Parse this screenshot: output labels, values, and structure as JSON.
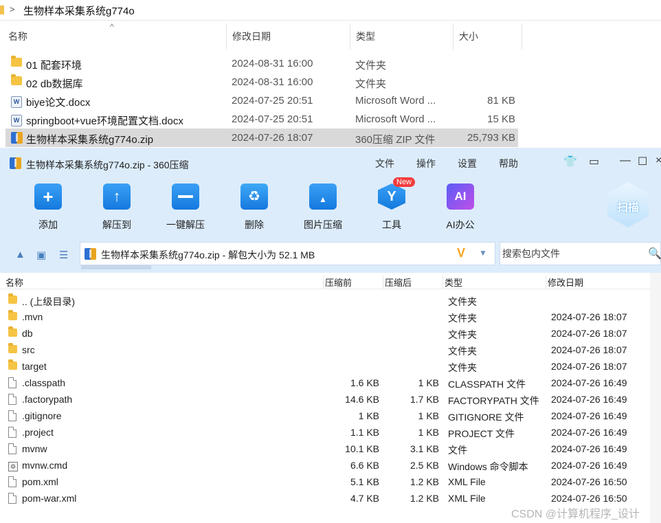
{
  "explorer": {
    "path": "生物样本采集系统g774o",
    "columns": {
      "name": "名称",
      "date": "修改日期",
      "type": "类型",
      "size": "大小"
    },
    "rows": [
      {
        "icon": "folder-icon",
        "name": "01 配套环境",
        "date": "2024-08-31 16:00",
        "type": "文件夹",
        "size": ""
      },
      {
        "icon": "folder-icon",
        "name": "02 db数据库",
        "date": "2024-08-31 16:00",
        "type": "文件夹",
        "size": ""
      },
      {
        "icon": "word-doc-icon",
        "name": "biye论文.docx",
        "date": "2024-07-25 20:51",
        "type": "Microsoft Word ...",
        "size": "81 KB"
      },
      {
        "icon": "word-doc-icon",
        "name": "springboot+vue环境配置文档.docx",
        "date": "2024-07-25 20:51",
        "type": "Microsoft Word ...",
        "size": "15 KB"
      },
      {
        "icon": "zip-icon",
        "name": "生物样本采集系统g774o.zip",
        "date": "2024-07-26 18:07",
        "type": "360压缩 ZIP 文件",
        "size": "25,793 KB",
        "selected": true
      }
    ]
  },
  "window": {
    "title": "生物样本采集系统g774o.zip - 360压缩",
    "menu": [
      "文件",
      "操作",
      "设置",
      "帮助"
    ],
    "toolbar": [
      {
        "label": "添加",
        "icon": "add-icon"
      },
      {
        "label": "解压到",
        "icon": "extract-icon"
      },
      {
        "label": "一键解压",
        "icon": "one-click-extract-icon"
      },
      {
        "label": "删除",
        "icon": "delete-icon"
      },
      {
        "label": "图片压缩",
        "icon": "image-compress-icon"
      },
      {
        "label": "工具",
        "icon": "tools-icon"
      },
      {
        "label": "AI办公",
        "icon": "ai-office-icon"
      }
    ],
    "new_badge": "New",
    "scan_label": "扫描",
    "path_text": "生物样本采集系统g774o.zip - 解包大小为 52.1 MB",
    "search_placeholder": "搜索包内文件",
    "columns": {
      "name": "名称",
      "packed": "压缩前",
      "compressed": "压缩后",
      "type": "类型",
      "modified": "修改日期"
    },
    "files": [
      {
        "icon": "folder-icon",
        "name": ".. (上级目录)",
        "packed": "",
        "compressed": "",
        "type": "文件夹",
        "modified": ""
      },
      {
        "icon": "folder-icon",
        "name": ".mvn",
        "packed": "",
        "compressed": "",
        "type": "文件夹",
        "modified": "2024-07-26 18:07"
      },
      {
        "icon": "folder-icon",
        "name": "db",
        "packed": "",
        "compressed": "",
        "type": "文件夹",
        "modified": "2024-07-26 18:07"
      },
      {
        "icon": "folder-icon",
        "name": "src",
        "packed": "",
        "compressed": "",
        "type": "文件夹",
        "modified": "2024-07-26 18:07"
      },
      {
        "icon": "folder-icon",
        "name": "target",
        "packed": "",
        "compressed": "",
        "type": "文件夹",
        "modified": "2024-07-26 18:07"
      },
      {
        "icon": "file-icon",
        "name": ".classpath",
        "packed": "1.6 KB",
        "compressed": "1 KB",
        "type": "CLASSPATH 文件",
        "modified": "2024-07-26 16:49"
      },
      {
        "icon": "file-icon",
        "name": ".factorypath",
        "packed": "14.6 KB",
        "compressed": "1.7 KB",
        "type": "FACTORYPATH 文件",
        "modified": "2024-07-26 16:49"
      },
      {
        "icon": "file-icon",
        "name": ".gitignore",
        "packed": "1 KB",
        "compressed": "1 KB",
        "type": "GITIGNORE 文件",
        "modified": "2024-07-26 16:49"
      },
      {
        "icon": "file-icon",
        "name": ".project",
        "packed": "1.1 KB",
        "compressed": "1 KB",
        "type": "PROJECT 文件",
        "modified": "2024-07-26 16:49"
      },
      {
        "icon": "file-icon",
        "name": "mvnw",
        "packed": "10.1 KB",
        "compressed": "3.1 KB",
        "type": "文件",
        "modified": "2024-07-26 16:49"
      },
      {
        "icon": "cmd-file-icon",
        "name": "mvnw.cmd",
        "packed": "6.6 KB",
        "compressed": "2.5 KB",
        "type": "Windows 命令脚本",
        "modified": "2024-07-26 16:49"
      },
      {
        "icon": "file-icon",
        "name": "pom.xml",
        "packed": "5.1 KB",
        "compressed": "1.2 KB",
        "type": "XML File",
        "modified": "2024-07-26 16:50"
      },
      {
        "icon": "file-icon",
        "name": "pom-war.xml",
        "packed": "4.7 KB",
        "compressed": "1.2 KB",
        "type": "XML File",
        "modified": "2024-07-26 16:50"
      }
    ]
  },
  "watermark": "CSDN @计算机程序_设计"
}
